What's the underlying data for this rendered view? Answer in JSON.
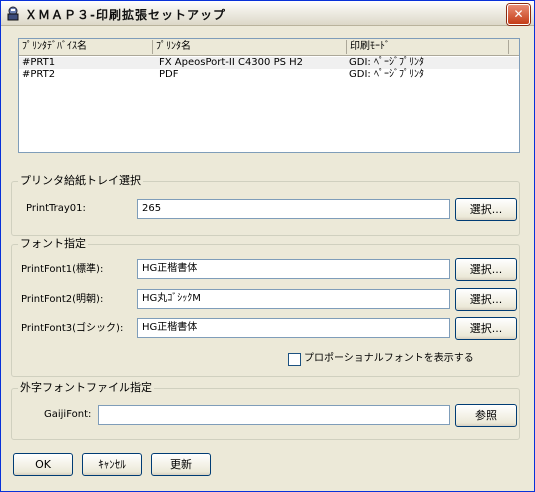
{
  "window": {
    "title": "ＸＭＡＰ３-印刷拡張セットアップ",
    "close_label": "✕"
  },
  "printer_list": {
    "columns": [
      "ﾌﾟﾘﾝﾀﾃﾞﾊﾞｲｽ名",
      "ﾌﾟﾘﾝﾀ名",
      "印刷ﾓｰﾄﾞ"
    ],
    "rows": [
      {
        "device": "#PRT1",
        "name": "FX ApeosPort-II C4300 PS H2",
        "mode": "GDI: ﾍﾟｰｼﾞﾌﾟﾘﾝﾀ"
      },
      {
        "device": "#PRT2",
        "name": "PDF",
        "mode": "GDI: ﾍﾟｰｼﾞﾌﾟﾘﾝﾀ"
      }
    ]
  },
  "tray_group": {
    "title": "プリンタ給紙トレイ選択",
    "label": "PrintTray01:",
    "value": "265",
    "select_label": "選択..."
  },
  "font_group": {
    "title": "フォント指定",
    "fonts": [
      {
        "label": "PrintFont1(標準):",
        "value": "HG正楷書体",
        "select_label": "選択..."
      },
      {
        "label": "PrintFont2(明朝):",
        "value": "HG丸ｺﾞｼｯｸM",
        "select_label": "選択..."
      },
      {
        "label": "PrintFont3(ゴシック):",
        "value": "HG正楷書体",
        "select_label": "選択..."
      }
    ],
    "proportional_label": "プロポーショナルフォントを表示する",
    "proportional_checked": false
  },
  "gaiji_group": {
    "title": "外字フォントファイル指定",
    "label": "GaijiFont:",
    "value": "",
    "browse_label": "参照"
  },
  "buttons": {
    "ok": "OK",
    "cancel": "ｷｬﾝｾﾙ",
    "update": "更新"
  }
}
